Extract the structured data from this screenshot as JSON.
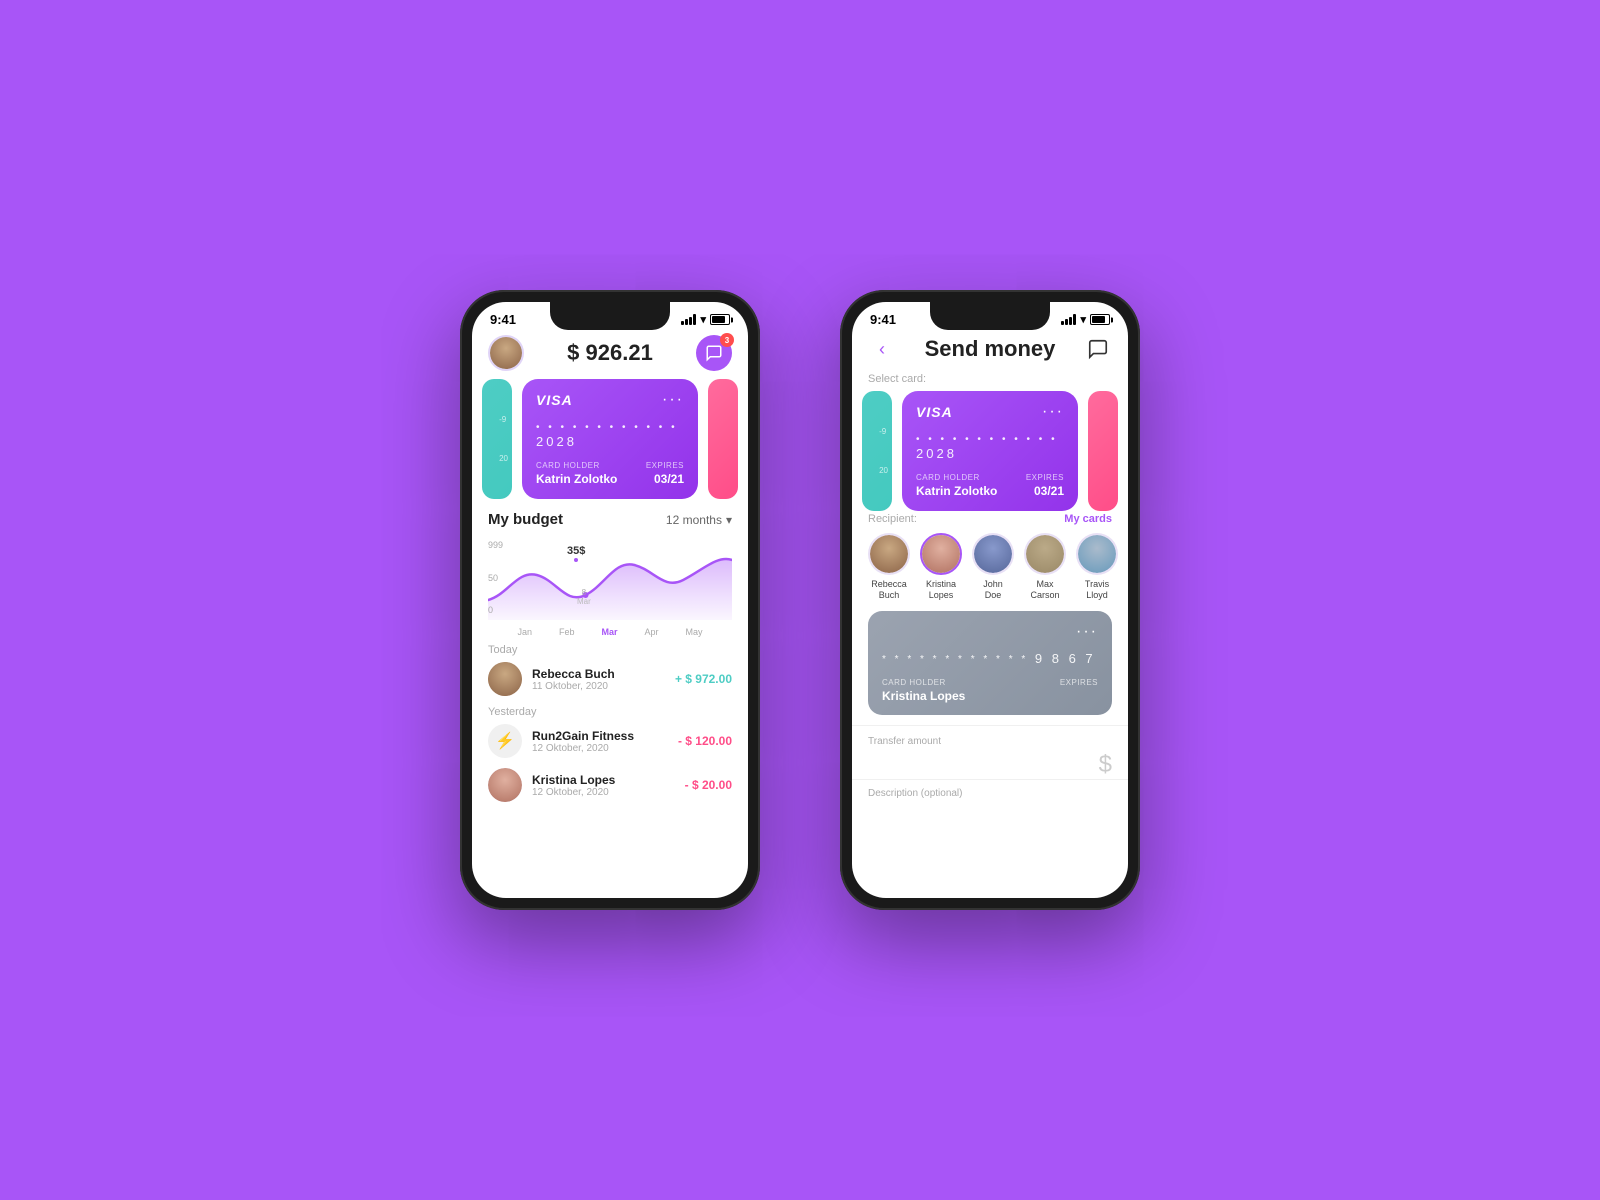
{
  "page": {
    "background": "#a855f7"
  },
  "phone1": {
    "status": {
      "time": "9:41",
      "battery_pct": 80
    },
    "header": {
      "balance": "$ 926.21",
      "notif_count": "3"
    },
    "cards": [
      {
        "id": "card-left-snippet",
        "color": "teal",
        "number_hint": "-9",
        "amount_hint": "20"
      },
      {
        "id": "card-main",
        "brand": "VISA",
        "number": "• • • •  • • • •  • • • •  2028",
        "dots": "• • • •  • • • •  • • • •",
        "last4": "2028",
        "holder_label": "CARD HOLDER",
        "holder": "Katrin Zolotko",
        "expires_label": "EXPIRES",
        "expires": "03/21"
      },
      {
        "id": "card-right-snippet",
        "color": "pink"
      }
    ],
    "budget": {
      "title": "My budget",
      "period": "12 months",
      "y_labels": [
        "999",
        "50",
        "0"
      ],
      "x_labels": [
        "Jan",
        "Feb",
        "Mar",
        "Apr",
        "May"
      ],
      "tooltip_amount": "35$",
      "tooltip_value": "8",
      "tooltip_month": "Mar"
    },
    "transactions": [
      {
        "section": "Today",
        "items": [
          {
            "name": "Rebecca Buch",
            "date": "11 Oktober, 2020",
            "amount": "+ $ 972.00",
            "type": "positive",
            "icon": "person"
          }
        ]
      },
      {
        "section": "Yesterday",
        "items": [
          {
            "name": "Run2Gain Fitness",
            "date": "12 Oktober, 2020",
            "amount": "- $ 120.00",
            "type": "negative",
            "icon": "fitness"
          },
          {
            "name": "Kristina Lopes",
            "date": "12 Oktober, 2020",
            "amount": "- $ 20.00",
            "type": "negative",
            "icon": "person"
          }
        ]
      }
    ]
  },
  "phone2": {
    "status": {
      "time": "9:41"
    },
    "header": {
      "title": "Send money",
      "back_icon": "‹",
      "chat_icon": "💬"
    },
    "select_card_label": "Select card:",
    "card": {
      "brand": "VISA",
      "dots": "• • • •  • • • •  • • • •",
      "last4": "2028",
      "holder_label": "CARD HOLDER",
      "holder": "Katrin Zolotko",
      "expires_label": "EXPIRES",
      "expires": "03/21"
    },
    "recipient_label": "Recipient:",
    "my_cards_label": "My cards",
    "recipients": [
      {
        "name": "Rebecca\nBuch",
        "name_l1": "Rebecca",
        "name_l2": "Buch",
        "selected": false,
        "face": "face-1"
      },
      {
        "name": "Kristina\nLopes",
        "name_l1": "Kristina",
        "name_l2": "Lopes",
        "selected": true,
        "face": "face-2"
      },
      {
        "name": "John\nDoe",
        "name_l1": "John",
        "name_l2": "Doe",
        "selected": false,
        "face": "face-3"
      },
      {
        "name": "Max\nCarson",
        "name_l1": "Max",
        "name_l2": "Carson",
        "selected": false,
        "face": "face-4"
      },
      {
        "name": "Travis\nLloyd",
        "name_l1": "Travis",
        "name_l2": "Lloyd",
        "selected": false,
        "face": "face-5"
      }
    ],
    "recipient_card": {
      "dots": "* * * *  * * * *  * * * *",
      "last4": "9 8 6 7",
      "holder_label": "CARD HOLDER",
      "holder": "Kristina Lopes",
      "expires_label": "EXPIRES"
    },
    "transfer": {
      "label": "Transfer amount",
      "currency_symbol": "$"
    },
    "description": {
      "label": "Description (optional)"
    }
  }
}
